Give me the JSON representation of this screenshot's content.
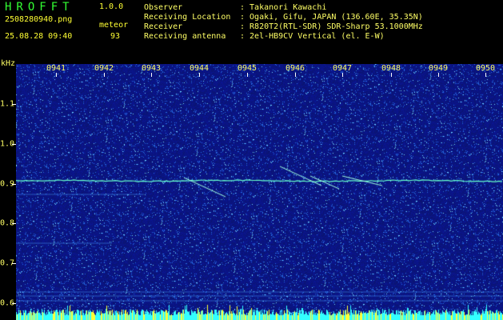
{
  "app": {
    "logo": "HROFFT",
    "version": "1.0.0"
  },
  "file": {
    "name": "2508280940.png",
    "timestamp": "25.08.28 09:40"
  },
  "detection": {
    "mode": "meteor",
    "count": "93"
  },
  "station": {
    "rows": [
      {
        "label": "Observer",
        "value": ": Takanori Kawachi"
      },
      {
        "label": "Receiving Location",
        "value": ": Ogaki, Gifu, JAPAN (136.60E, 35.35N)"
      },
      {
        "label": "Receiver",
        "value": ": R820T2(RTL-SDR) SDR-Sharp 53.1000MHz"
      },
      {
        "label": "Receiving antenna",
        "value": ": 2el-HB9CV Vertical (el. E-W)"
      }
    ]
  },
  "axis": {
    "unit": "kHz",
    "time_ticks": [
      "0941",
      "0942",
      "0943",
      "0944",
      "0945",
      "0946",
      "0947",
      "0948",
      "0949",
      "0950"
    ],
    "freq_ticks": [
      "1.1",
      "1.0",
      "0.9",
      "0.8",
      "0.7",
      "0.6"
    ]
  },
  "colors": {
    "background": "#000000",
    "spectrum_base": "#0a1a7a",
    "trace": "#66ffcc",
    "header_text": "#ffff66",
    "logo": "#33ff33"
  }
}
